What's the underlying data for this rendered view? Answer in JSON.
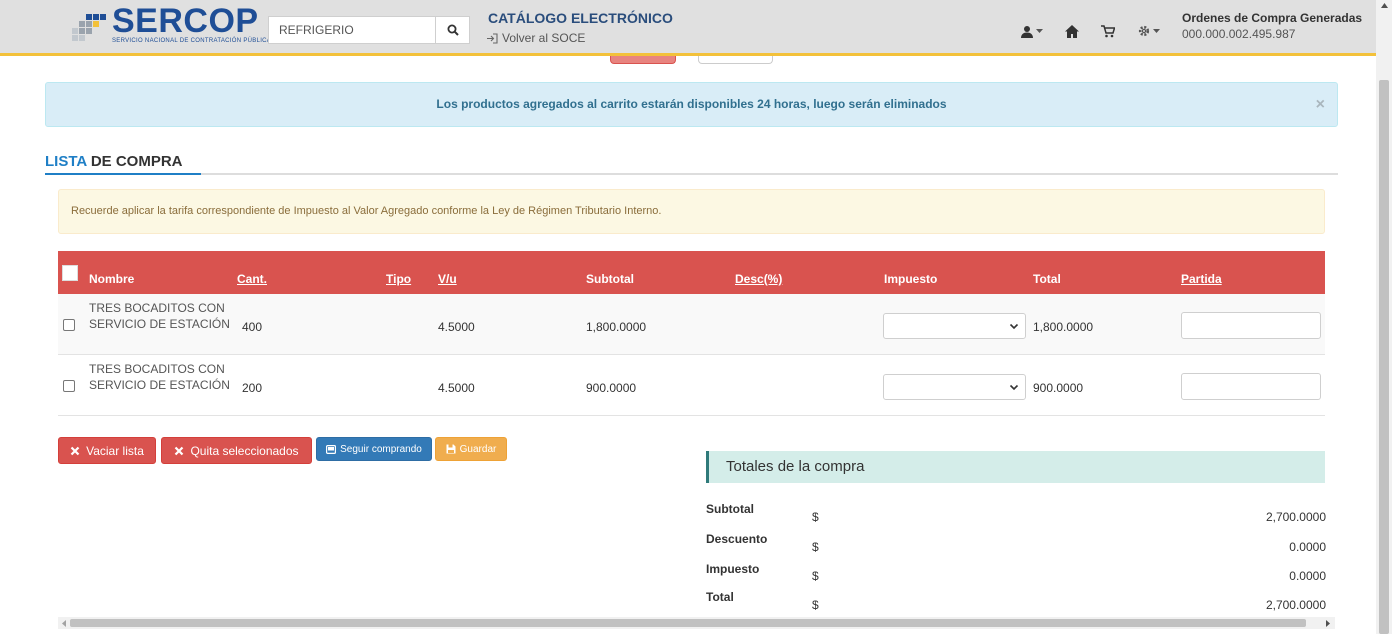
{
  "header": {
    "logo_title": "SERCOP",
    "logo_subtitle": "SERVICIO NACIONAL DE CONTRATACIÓN PÚBLICA",
    "search_value": "REFRIGERIO",
    "catalog_title": "CATÁLOGO ELECTRÓNICO",
    "back_link": "Volver al SOCE",
    "orders_title": "Ordenes de Compra Generadas",
    "orders_number": "000.000.002.495.987",
    "icons": [
      "user-icon",
      "home-icon",
      "cart-icon",
      "gear-icon"
    ]
  },
  "alert": {
    "message": "Los productos agregados al carrito estarán disponibles 24 horas, luego serán eliminados",
    "close": "×"
  },
  "section": {
    "title_part1": "LISTA",
    "title_part2": " DE COMPRA"
  },
  "warning": {
    "message": "Recuerde aplicar la tarifa correspondiente de Impuesto al Valor Agregado conforme la Ley de Régimen Tributario Interno."
  },
  "table": {
    "columns": {
      "nombre": "Nombre",
      "cant": "Cant.",
      "tipo": "Tipo",
      "vu": "V/u",
      "subtotal": "Subtotal",
      "desc": "Desc(%)",
      "impuesto": "Impuesto",
      "total": "Total",
      "partida": "Partida"
    },
    "rows": [
      {
        "nombre": "TRES BOCADITOS CON SERVICIO DE ESTACIÓN",
        "cant": "400",
        "tipo": "",
        "vu": "4.5000",
        "subtotal": "1,800.0000",
        "desc": "",
        "impuesto": "",
        "total": "1,800.0000",
        "partida": ""
      },
      {
        "nombre": "TRES BOCADITOS CON SERVICIO DE ESTACIÓN",
        "cant": "200",
        "tipo": "",
        "vu": "4.5000",
        "subtotal": "900.0000",
        "desc": "",
        "impuesto": "",
        "total": "900.0000",
        "partida": ""
      }
    ]
  },
  "buttons": {
    "vaciar": "Vaciar lista",
    "quitar": "Quita seleccionados",
    "seguir": "Seguir comprando",
    "guardar": "Guardar"
  },
  "totals": {
    "header": "Totales de la compra",
    "currency": "$",
    "rows": [
      {
        "label": "Subtotal",
        "value": "2,700.0000"
      },
      {
        "label": "Descuento",
        "value": "0.0000"
      },
      {
        "label": "Impuesto",
        "value": "0.0000"
      },
      {
        "label": "Total",
        "value": "2,700.0000"
      }
    ]
  },
  "colors": {
    "table_header": "#d9534f",
    "accent_blue": "#1f7fc6",
    "header_border": "#f3c13a",
    "info_bg": "#d9edf7",
    "warning_bg": "#fcf8e3",
    "totals_bg": "#d4ede9"
  }
}
